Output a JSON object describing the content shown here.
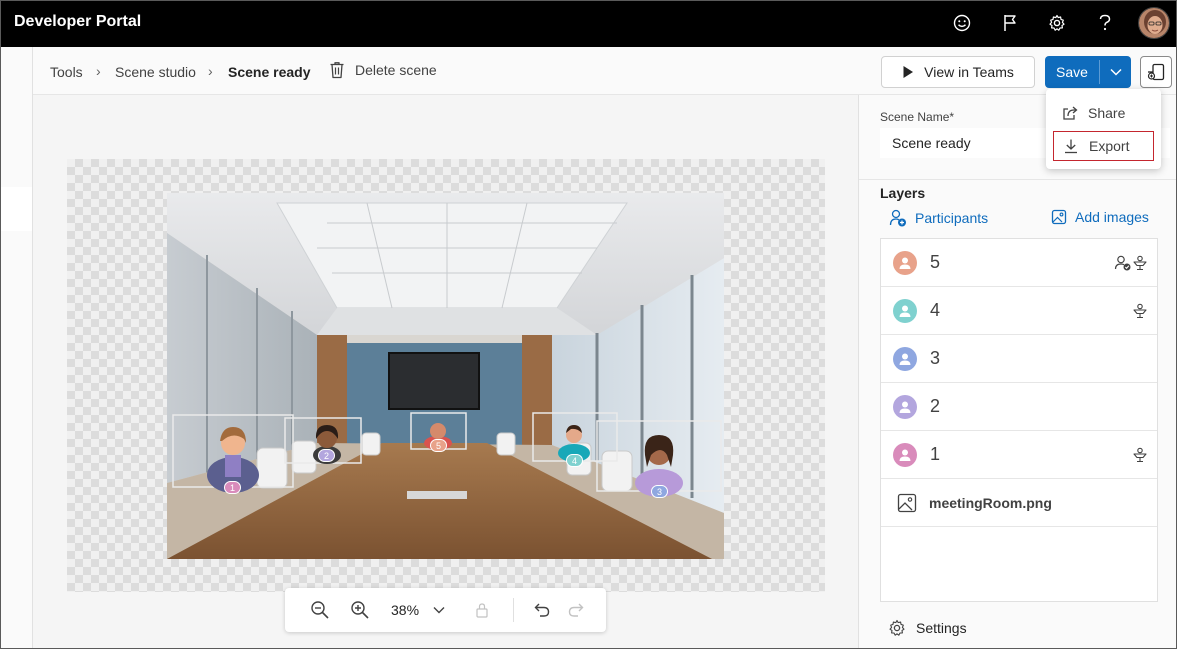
{
  "app": {
    "title": "Developer Portal"
  },
  "topbar": {
    "icons": [
      "smiley-icon",
      "flag-icon",
      "gear-icon",
      "help-icon"
    ],
    "avatar": "user-avatar"
  },
  "breadcrumb": {
    "items": [
      "Tools",
      "Scene studio",
      "Scene ready"
    ],
    "separator": "›"
  },
  "toolbar": {
    "delete_label": "Delete scene",
    "view_label": "View in Teams",
    "save_label": "Save"
  },
  "save_menu": {
    "items": [
      "Share",
      "Export"
    ],
    "focused": "Export"
  },
  "zoom": {
    "value": "38%"
  },
  "panel": {
    "scene_name_label": "Scene Name*",
    "scene_name_value": "Scene ready",
    "layers_title": "Layers",
    "participants_label": "Participants",
    "add_images_label": "Add images",
    "layers": [
      {
        "label": "5",
        "color": "#e8a28a"
      },
      {
        "label": "4",
        "color": "#7fd1cf"
      },
      {
        "label": "3",
        "color": "#8fa7e0"
      },
      {
        "label": "2",
        "color": "#b3a6de"
      },
      {
        "label": "1",
        "color": "#d98bbb"
      }
    ],
    "image_layer": "meetingRoom.png",
    "settings_label": "Settings"
  },
  "scene": {
    "seat_numbers": [
      "1",
      "2",
      "5",
      "4",
      "3"
    ],
    "seat_colors": [
      "#d98bbb",
      "#b3a6de",
      "#e8a28a",
      "#7fd1cf",
      "#8fa7e0"
    ]
  },
  "colors": {
    "accent": "#0f6cbd",
    "focus_outline": "#c4262e"
  }
}
